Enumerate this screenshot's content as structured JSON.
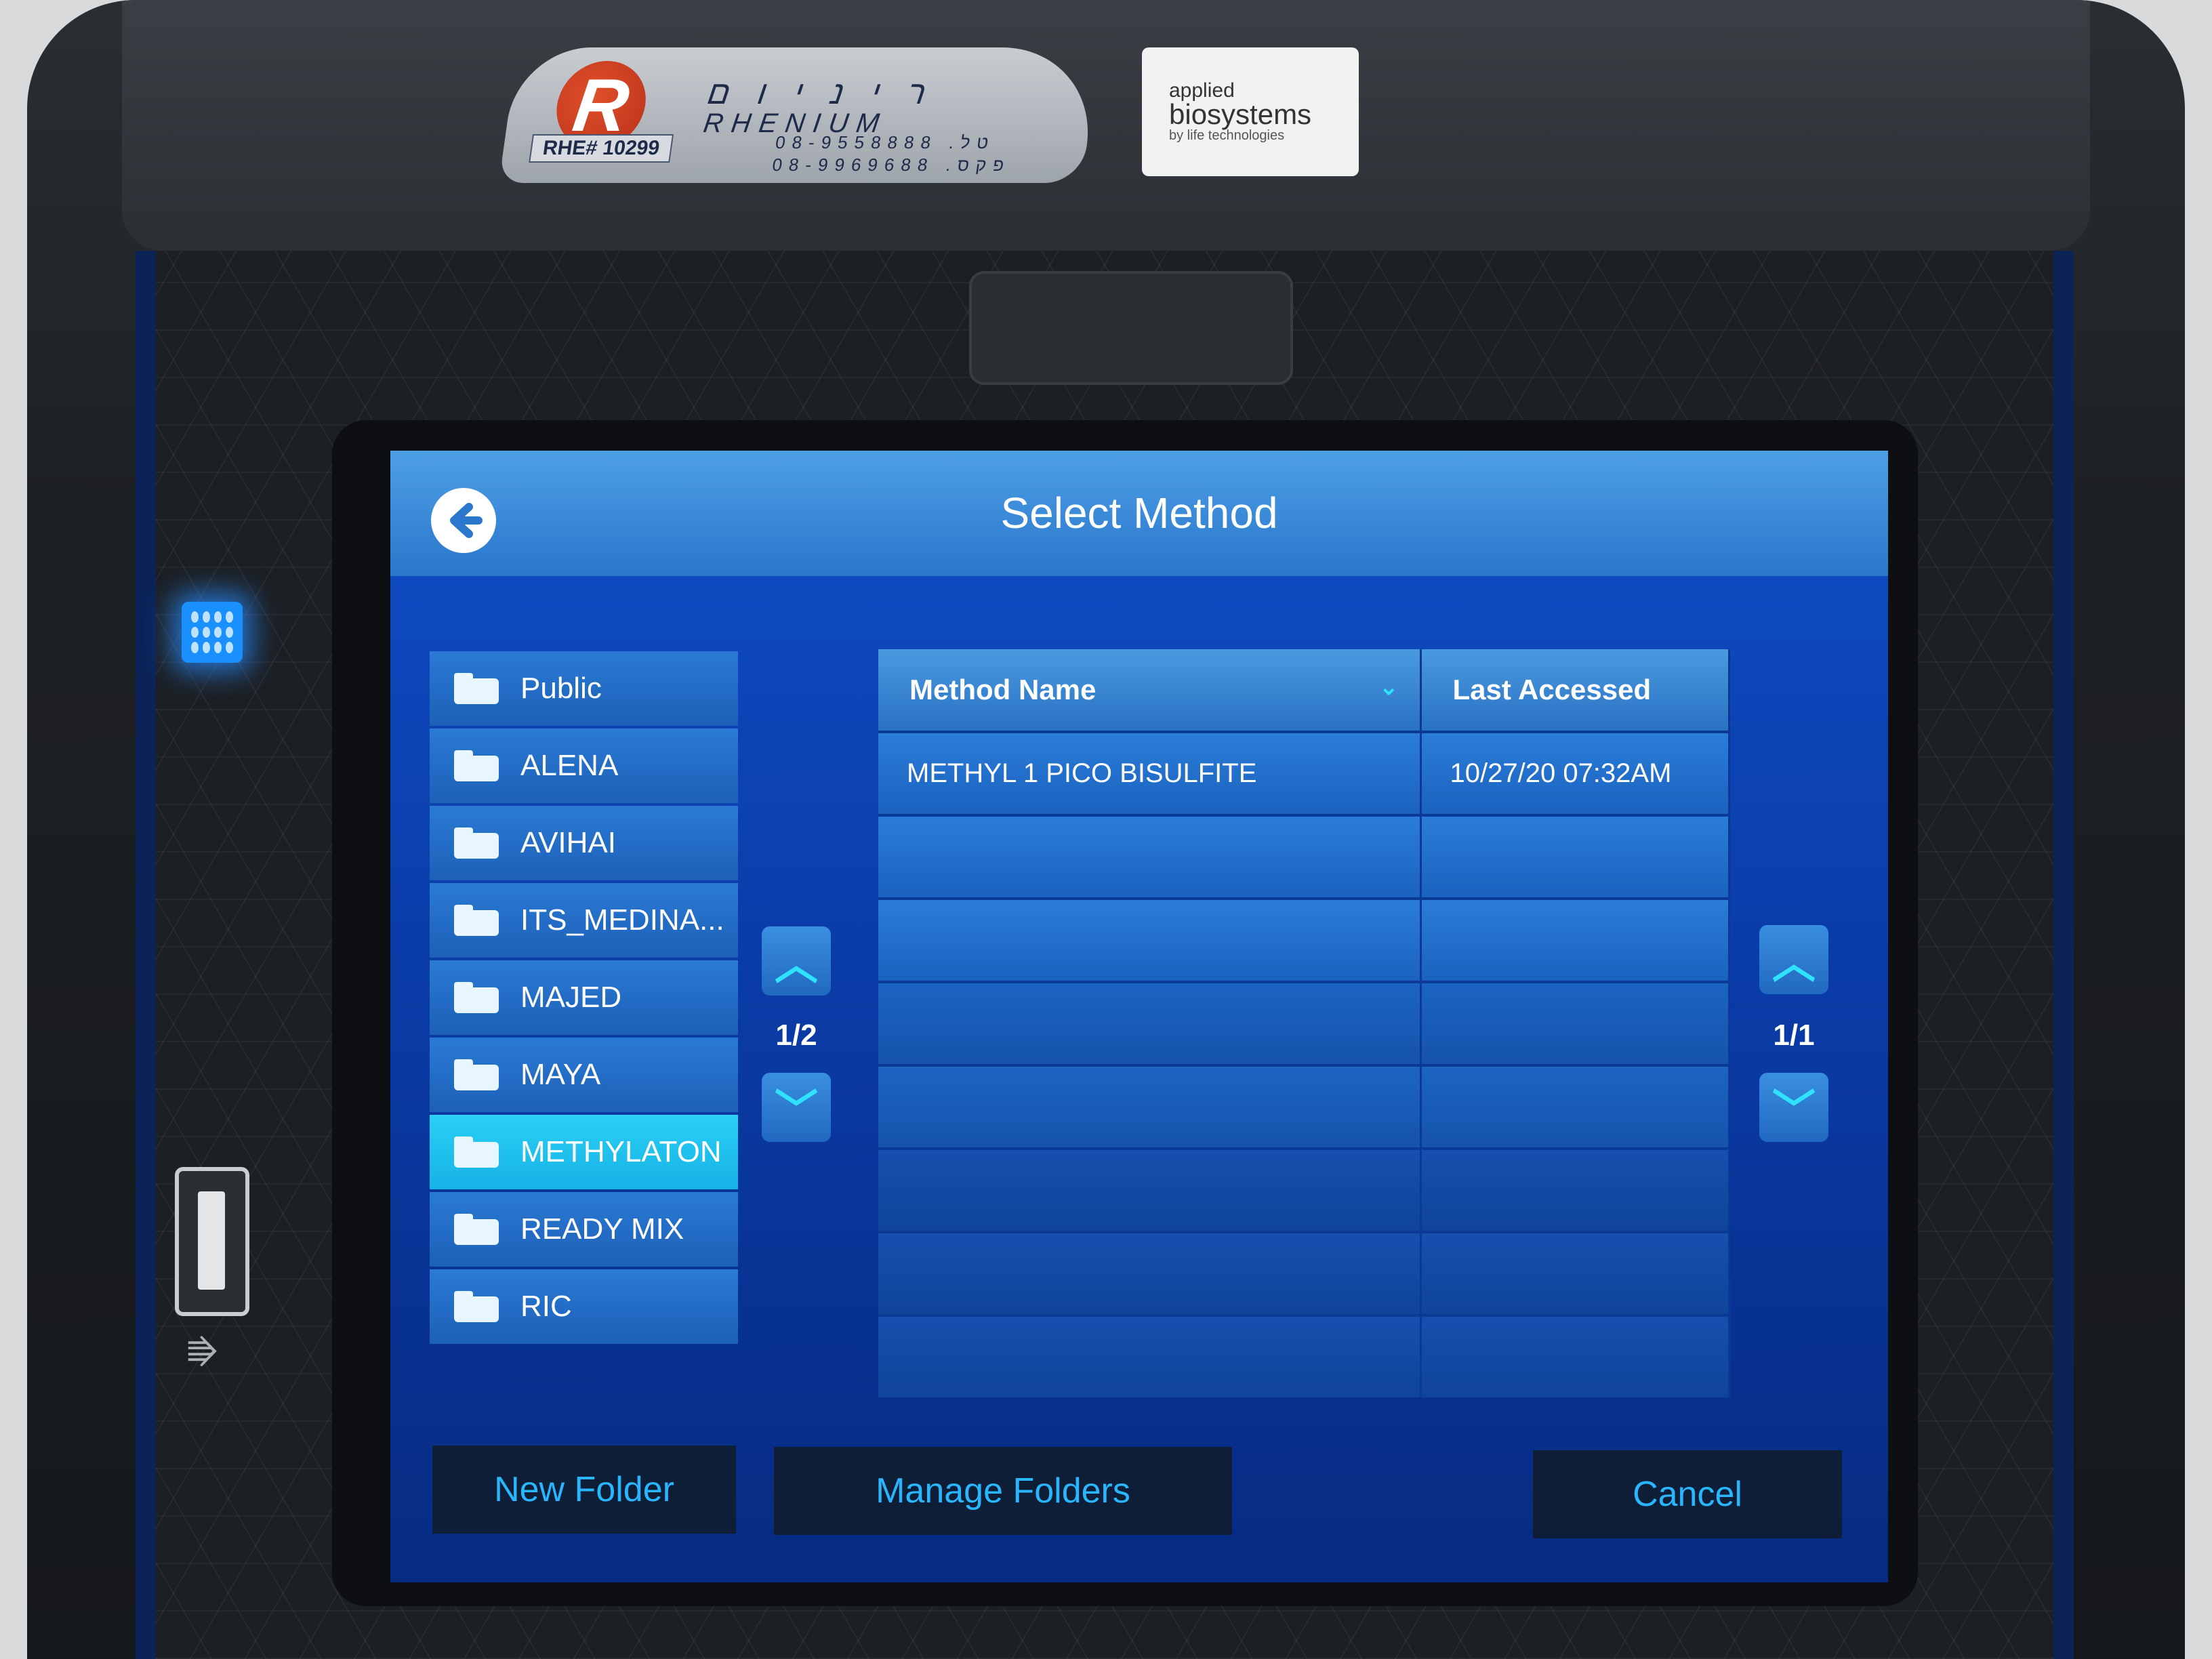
{
  "device": {
    "distributor": {
      "hebrew_name": "ר י נ י ו ם",
      "brand": "RHENIUM",
      "id_label": "RHE# 10299",
      "phone_line": "08-9558888 .טל",
      "fax_line": "08-9969688 .פקס"
    },
    "manufacturer": {
      "line1": "applied",
      "line2": "biosystems",
      "line3": "by life technologies"
    },
    "icons": {
      "power_led": "power-indicator-led",
      "usb": "usb-symbol"
    }
  },
  "screen": {
    "title": "Select Method",
    "back_icon": "back-arrow-icon",
    "folders": [
      {
        "label": "Public",
        "selected": false
      },
      {
        "label": "ALENA",
        "selected": false
      },
      {
        "label": "AVIHAI",
        "selected": false
      },
      {
        "label": "ITS_MEDINA...",
        "selected": false
      },
      {
        "label": "MAJED",
        "selected": false
      },
      {
        "label": "MAYA",
        "selected": false
      },
      {
        "label": "METHYLATON",
        "selected": true
      },
      {
        "label": "READY MIX",
        "selected": false
      },
      {
        "label": "RIC",
        "selected": false
      }
    ],
    "folder_pager": {
      "up_icon": "chevron-up-icon",
      "page": "1/2",
      "down_icon": "chevron-down-icon"
    },
    "method_pager": {
      "up_icon": "chevron-up-icon",
      "page": "1/1",
      "down_icon": "chevron-down-icon"
    },
    "table": {
      "columns": [
        "Method Name",
        "Last Accessed"
      ],
      "sort_icon": "sort-down-icon",
      "rows": [
        {
          "name": "METHYL 1 PICO BISULFITE",
          "last_accessed": "10/27/20   07:32AM"
        },
        {
          "name": "",
          "last_accessed": ""
        },
        {
          "name": "",
          "last_accessed": ""
        },
        {
          "name": "",
          "last_accessed": ""
        },
        {
          "name": "",
          "last_accessed": ""
        },
        {
          "name": "",
          "last_accessed": ""
        },
        {
          "name": "",
          "last_accessed": ""
        },
        {
          "name": "",
          "last_accessed": ""
        }
      ]
    },
    "buttons": {
      "new_folder": "New Folder",
      "manage_folders": "Manage Folders",
      "cancel": "Cancel"
    },
    "colors": {
      "accent": "#2fe2ff",
      "selected_folder": "#16b2e6",
      "title_bar": "#3a8ad8",
      "button_text": "#29b6ff"
    }
  }
}
